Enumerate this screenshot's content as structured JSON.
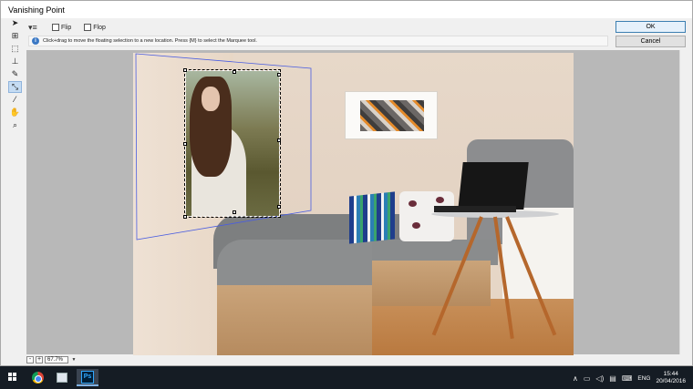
{
  "window": {
    "title": "Vanishing Point",
    "ok_label": "OK",
    "cancel_label": "Cancel"
  },
  "options": {
    "flip_label": "Flip",
    "flop_label": "Flop",
    "flip_checked": false,
    "flop_checked": false
  },
  "info": {
    "icon": "info-icon",
    "text": "Click+drag to move the floating selection to a new location. Press {M} to select the Marquee tool."
  },
  "tools": [
    {
      "name": "edit-plane-tool",
      "icon": "arrow-icon",
      "active": false
    },
    {
      "name": "create-plane-tool",
      "icon": "grid-plus-icon",
      "active": false
    },
    {
      "name": "marquee-tool",
      "icon": "marquee-icon",
      "active": false
    },
    {
      "name": "stamp-tool",
      "icon": "stamp-icon",
      "active": false
    },
    {
      "name": "brush-tool",
      "icon": "brush-icon",
      "active": false
    },
    {
      "name": "transform-tool",
      "icon": "transform-icon",
      "active": true
    },
    {
      "name": "eyedropper-tool",
      "icon": "eyedropper-icon",
      "active": false
    },
    {
      "name": "hand-tool",
      "icon": "hand-icon",
      "active": false
    },
    {
      "name": "zoom-tool",
      "icon": "magnifier-icon",
      "active": false
    }
  ],
  "zoom": {
    "value": "67.7%"
  },
  "taskbar": {
    "apps": [
      {
        "name": "chrome",
        "icon": "chrome-icon"
      },
      {
        "name": "file-explorer",
        "icon": "file-explorer-icon"
      },
      {
        "name": "photoshop",
        "icon": "photoshop-icon",
        "label": "Ps",
        "active": true
      }
    ],
    "language": "ENG",
    "time": "15:44",
    "date": "20/04/2016"
  },
  "colors": {
    "accent": "#3c7fb1",
    "taskbar_bg": "#151c24",
    "plane_grid": "#4a5de0"
  }
}
